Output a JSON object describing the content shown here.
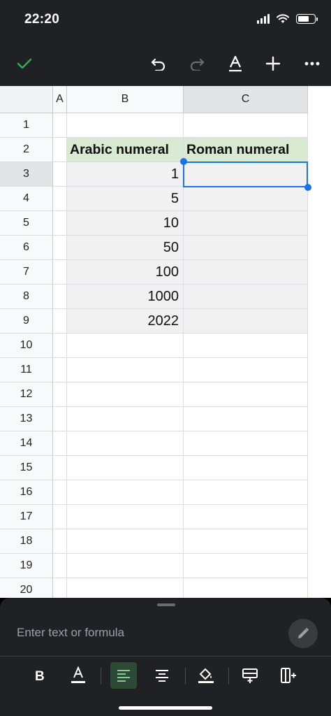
{
  "status_bar": {
    "time": "22:20"
  },
  "toolbar": {
    "icons": [
      "check-icon",
      "undo-icon",
      "redo-icon",
      "text-format-icon",
      "plus-icon",
      "more-icon"
    ]
  },
  "sheet": {
    "columns": [
      "A",
      "B",
      "C"
    ],
    "rows": [
      "1",
      "2",
      "3",
      "4",
      "5",
      "6",
      "7",
      "8",
      "9",
      "10",
      "11",
      "12",
      "13",
      "14",
      "15",
      "16",
      "17",
      "18",
      "19",
      "20"
    ],
    "selected_row": "3",
    "selected_column": "C",
    "header_row": {
      "b": "Arabic numeral",
      "c": "Roman numeral"
    },
    "values_b": [
      "1",
      "5",
      "10",
      "50",
      "100",
      "1000",
      "2022"
    ],
    "header_fill": "#d9ead3",
    "selection_color": "#1a73e8"
  },
  "formula_bar": {
    "placeholder": "Enter text or formula"
  },
  "format_bar": {
    "icons": [
      "bold-icon",
      "text-color-icon",
      "align-left-icon",
      "align-center-icon",
      "fill-color-icon",
      "insert-row-icon",
      "insert-column-icon"
    ]
  }
}
